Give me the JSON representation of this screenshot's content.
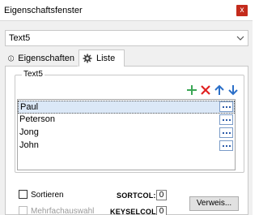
{
  "window": {
    "title": "Eigenschaftsfenster",
    "close_label": "x"
  },
  "selector": {
    "value": "Text5"
  },
  "tabs": [
    {
      "label": "Eigenschaften",
      "icon": "info-icon",
      "active": false
    },
    {
      "label": "Liste",
      "icon": "gear-icon",
      "active": true
    }
  ],
  "group": {
    "label": "Text5",
    "toolbar": [
      "add-icon",
      "delete-icon",
      "arrow-up-icon",
      "arrow-down-icon"
    ],
    "items": [
      "Paul",
      "Peterson",
      "Jong",
      "John"
    ],
    "selected_index": 0
  },
  "options": {
    "sort_label": "Sortieren",
    "multi_label": "Mehrfachauswahl",
    "sortcol_label": "SORTCOL:",
    "sortcol_value": "0",
    "keyselcol_label": "KEYSELCOL:",
    "keyselcol_value": "0",
    "verweis_label": "Verweis..."
  },
  "colors": {
    "close": "#c42b1c",
    "add": "#3aa655",
    "delete": "#e02020",
    "arrows": "#2b6fc8",
    "selection": "#dbe8f7"
  }
}
